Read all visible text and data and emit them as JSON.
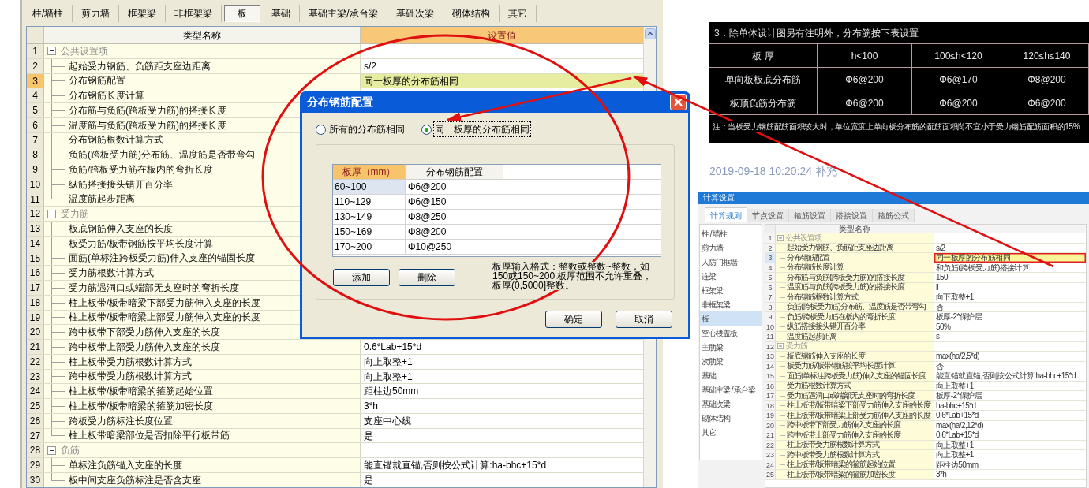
{
  "app": {
    "tabs": [
      {
        "label": "柱/墙柱",
        "selected": false
      },
      {
        "label": "剪力墙",
        "selected": false
      },
      {
        "label": "框架梁",
        "selected": false
      },
      {
        "label": "非框架梁",
        "selected": false
      },
      {
        "label": "板",
        "selected": true
      },
      {
        "label": "基础",
        "selected": false
      },
      {
        "label": "基础主梁/承台梁",
        "selected": false
      },
      {
        "label": "基础次梁",
        "selected": false
      },
      {
        "label": "砌体结构",
        "selected": false
      },
      {
        "label": "其它",
        "selected": false
      }
    ],
    "settings_table": {
      "columns": [
        "类型名称",
        "设置值"
      ],
      "groups": [
        {
          "number": "1",
          "name": "公共设置项",
          "expanded": true,
          "selected": false,
          "children": [
            {
              "number": "2",
              "name": "起始受力钢筋、负筋距支座边距离",
              "value": "s/2",
              "selected": false
            },
            {
              "number": "3",
              "name": "分布钢筋配置",
              "value": "同一板厚的分布筋相同",
              "selected": true
            },
            {
              "number": "4",
              "name": "分布钢筋长度计算",
              "selected": false
            },
            {
              "number": "5",
              "name": "分布筋与负筋(跨板受力筋)的搭接长度",
              "selected": false
            },
            {
              "number": "6",
              "name": "温度筋与负筋(跨板受力筋)的搭接长度",
              "selected": false
            },
            {
              "number": "7",
              "name": "分布钢筋根数计算方式",
              "selected": false
            },
            {
              "number": "8",
              "name": "负筋(跨板受力筋)分布筋、温度筋是否带弯勾",
              "selected": false
            },
            {
              "number": "9",
              "name": "负筋/跨板受力筋在板内的弯折长度",
              "selected": false
            },
            {
              "number": "10",
              "name": "纵筋搭接接头错开百分率",
              "selected": false
            },
            {
              "number": "11",
              "name": "温度筋起步距离",
              "selected": false
            }
          ]
        },
        {
          "number": "12",
          "name": "受力筋",
          "expanded": true,
          "selected": false,
          "children": [
            {
              "number": "13",
              "name": "板底钢筋伸入支座的长度",
              "selected": false
            },
            {
              "number": "14",
              "name": "板受力筋/板带钢筋按平均长度计算",
              "selected": false
            },
            {
              "number": "15",
              "name": "面筋(单标注跨板受力筋)伸入支座的锚固长度",
              "selected": false
            },
            {
              "number": "16",
              "name": "受力筋根数计算方式",
              "selected": false
            },
            {
              "number": "17",
              "name": "受力筋遇洞口或端部无支座时的弯折长度",
              "selected": false
            },
            {
              "number": "18",
              "name": "柱上板带/板带暗梁下部受力筋伸入支座的长度",
              "selected": false
            },
            {
              "number": "19",
              "name": "柱上板带/板带暗梁上部受力筋伸入支座的长度",
              "selected": false
            },
            {
              "number": "20",
              "name": "跨中板带下部受力筋伸入支座的长度",
              "selected": false
            },
            {
              "number": "21",
              "name": "跨中板带上部受力筋伸入支座的长度",
              "value": "0.6*Lab+15*d",
              "selected": false
            },
            {
              "number": "22",
              "name": "柱上板带受力筋根数计算方式",
              "value": "向上取整+1",
              "selected": false
            },
            {
              "number": "23",
              "name": "跨中板带受力筋根数计算方式",
              "value": "向上取整+1",
              "selected": false
            },
            {
              "number": "24",
              "name": "柱上板带/板带暗梁的箍筋起始位置",
              "value": "距柱边50mm",
              "selected": false
            },
            {
              "number": "25",
              "name": "柱上板带/板带暗梁的箍筋加密长度",
              "value": "3*h",
              "selected": false
            },
            {
              "number": "26",
              "name": "跨板受力筋标注长度位置",
              "value": "支座中心线",
              "selected": false
            },
            {
              "number": "27",
              "name": "柱上板带暗梁部位是否扣除平行板带筋",
              "value": "是",
              "selected": false
            }
          ]
        },
        {
          "number": "28",
          "name": "负筋",
          "expanded": true,
          "selected": false,
          "children": [
            {
              "number": "29",
              "name": "单标注负筋锚入支座的长度",
              "value": "能直锚就直锚,否则按公式计算:ha-bhc+15*d",
              "selected": false
            },
            {
              "number": "30",
              "name": "板中间支座负筋标注是否含支座",
              "value": "是",
              "selected": false
            }
          ]
        }
      ]
    }
  },
  "dialog": {
    "title": "分布钢筋配置",
    "radios": [
      {
        "label": "所有的分布筋相同",
        "selected": false
      },
      {
        "label": "同一板厚的分布筋相同",
        "selected": true
      }
    ],
    "table": {
      "columns": [
        "板厚（mm）",
        "分布钢筋配置"
      ],
      "rows": [
        {
          "thickness": "60~100",
          "config": "Φ6@200",
          "selected": true
        },
        {
          "thickness": "110~129",
          "config": "Φ6@150",
          "selected": false
        },
        {
          "thickness": "130~149",
          "config": "Φ8@250",
          "selected": false
        },
        {
          "thickness": "150~169",
          "config": "Φ8@200",
          "selected": false
        },
        {
          "thickness": "170~200",
          "config": "Φ10@250",
          "selected": false
        }
      ]
    },
    "buttons": [
      "添加",
      "删除"
    ],
    "hint": "板厚输入格式：整数或整数~整数，如150或150~200.板厚范围不允许重叠，板厚(0,5000]整数。",
    "footer_buttons": [
      "确定",
      "取消"
    ]
  },
  "article": {
    "image_table": {
      "caption": "3．除单体设计图另有注明外，分布筋按下表设置",
      "header": [
        "板 厚",
        "h<100",
        "100≤h<120",
        "120≤h≤140"
      ],
      "rows": [
        {
          "label": "单向板板底分布筋",
          "cells": [
            "Φ6@200",
            "Φ6@170",
            "Φ8@200"
          ]
        },
        {
          "label": "板顶负筋分布筋",
          "cells": [
            "Φ6@200",
            "Φ6@200",
            "Φ6@200"
          ]
        }
      ],
      "note": "注：当板受力钢筋配筋面积较大时，单位宽度上单向板分布筋的配筋面积尚不宜小于受力钢筋配筋面积的15%"
    },
    "timestamp": "2019-09-18 10:20:24 补充",
    "screenshot": {
      "title": "计算设置",
      "tabs": [
        {
          "label": "计算规则",
          "selected": true
        },
        {
          "label": "节点设置",
          "selected": false
        },
        {
          "label": "箍筋设置",
          "selected": false
        },
        {
          "label": "搭接设置",
          "selected": false
        },
        {
          "label": "箍筋公式",
          "selected": false
        }
      ],
      "categories": [
        {
          "label": "柱 / 墙柱",
          "selected": false
        },
        {
          "label": "剪力墙",
          "selected": false
        },
        {
          "label": "人防门框墙",
          "selected": false
        },
        {
          "label": "连梁",
          "selected": false
        },
        {
          "label": "框架梁",
          "selected": false
        },
        {
          "label": "非框架梁",
          "selected": false
        },
        {
          "label": "板",
          "selected": true
        },
        {
          "label": "空心楼盖板",
          "selected": false
        },
        {
          "label": "主肋梁",
          "selected": false
        },
        {
          "label": "次肋梁",
          "selected": false
        },
        {
          "label": "基础",
          "selected": false
        },
        {
          "label": "基础主梁 / 承台梁",
          "selected": false
        },
        {
          "label": "基础次梁",
          "selected": false
        },
        {
          "label": "砌体结构",
          "selected": false
        },
        {
          "label": "其它",
          "selected": false
        }
      ],
      "table": {
        "columns": [
          "类型名称"
        ],
        "groups": [
          {
            "number": "1",
            "name": "公共设置项",
            "expanded": true,
            "selected": false,
            "children": [
              {
                "number": "2",
                "name": "起始受力钢筋、负筋距支座边距离",
                "value": "s/2",
                "selected": false
              },
              {
                "number": "3",
                "name": "分布钢筋配置",
                "value": "同一板厚的分布筋相同",
                "selected": true
              },
              {
                "number": "4",
                "name": "分布钢筋长度计算",
                "value": "和负筋(跨板受力筋)搭接计算",
                "selected": false
              },
              {
                "number": "5",
                "name": "分布筋与负筋(跨板受力筋)的搭接长度",
                "value": "150",
                "selected": false
              },
              {
                "number": "6",
                "name": "温度筋与负筋(跨板受力筋)的搭接长度",
                "value": "ll",
                "selected": false
              },
              {
                "number": "7",
                "name": "分布钢筋根数计算方式",
                "value": "向下取整+1",
                "selected": false
              },
              {
                "number": "8",
                "name": "负筋(跨板受力筋)分布筋、温度筋是否带弯勾",
                "value": "否",
                "selected": false
              },
              {
                "number": "9",
                "name": "负筋/跨板受力筋在板内的弯折长度",
                "value": "板厚-2*保护层",
                "selected": false
              },
              {
                "number": "10",
                "name": "纵筋搭接接头错开百分率",
                "value": "50%",
                "selected": false
              },
              {
                "number": "11",
                "name": "温度筋起步距离",
                "value": "s",
                "selected": false
              }
            ]
          },
          {
            "number": "12",
            "name": "受力筋",
            "expanded": true,
            "selected": false,
            "children": [
              {
                "number": "13",
                "name": "板底钢筋伸入支座的长度",
                "value": "max(ha/2,5*d)",
                "selected": false
              },
              {
                "number": "14",
                "name": "板受力筋/板带钢筋按平均长度计算",
                "value": "否",
                "selected": false
              },
              {
                "number": "15",
                "name": "面筋(单标注跨板受力筋)伸入支座的锚固长度",
                "value": "能直锚就直锚,否则按公式计算:ha-bhc+15*d",
                "selected": false
              },
              {
                "number": "16",
                "name": "受力筋根数计算方式",
                "value": "向上取整+1",
                "selected": false
              },
              {
                "number": "17",
                "name": "受力筋遇洞口或端部无支座时的弯折长度",
                "value": "板厚-2*保护层",
                "selected": false
              },
              {
                "number": "18",
                "name": "柱上板带/板带暗梁下部受力筋伸入支座的长度",
                "value": "ha-bhc+15*d",
                "selected": false
              },
              {
                "number": "19",
                "name": "柱上板带/板带暗梁上部受力筋伸入支座的长度",
                "value": "0.6*Lab+15*d",
                "selected": false
              },
              {
                "number": "20",
                "name": "跨中板带下部受力筋伸入支座的长度",
                "value": "max(ha/2,12*d)",
                "selected": false
              },
              {
                "number": "21",
                "name": "跨中板带上部受力筋伸入支座的长度",
                "value": "0.6*Lab+15*d",
                "selected": false
              },
              {
                "number": "22",
                "name": "柱上板带受力筋根数计算方式",
                "value": "向上取整+1",
                "selected": false
              },
              {
                "number": "23",
                "name": "跨中板带受力筋根数计算方式",
                "value": "向上取整+1",
                "selected": false
              },
              {
                "number": "24",
                "name": "柱上板带/板带暗梁的箍筋起始位置",
                "value": "距柱边50mm",
                "selected": false
              },
              {
                "number": "25",
                "name": "柱上板带/板带暗梁的箍筋加密长度",
                "value": "3*h",
                "selected": false
              }
            ]
          }
        ]
      }
    }
  }
}
